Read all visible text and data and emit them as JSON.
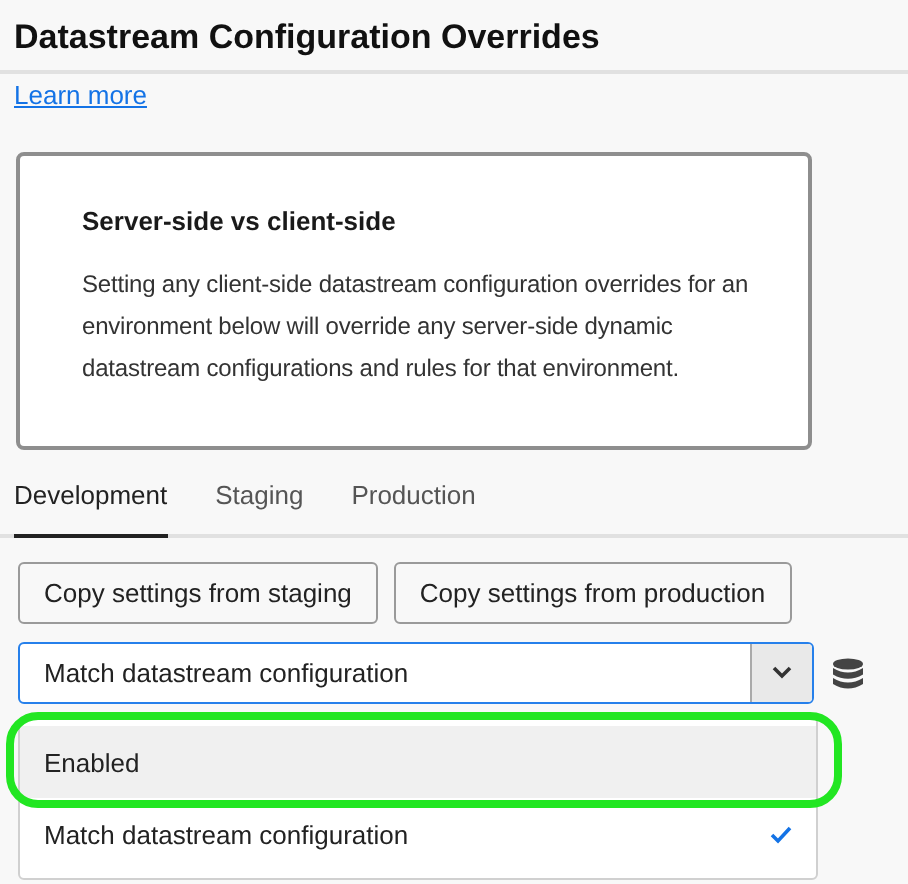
{
  "title": "Datastream Configuration Overrides",
  "learn_more": "Learn more",
  "info_card": {
    "heading": "Server-side vs client-side",
    "body": "Setting any client-side datastream configuration overrides for an environment below will override any server-side dynamic datastream configurations and rules for that environment."
  },
  "tabs": [
    {
      "label": "Development",
      "selected": true
    },
    {
      "label": "Staging",
      "selected": false
    },
    {
      "label": "Production",
      "selected": false
    }
  ],
  "buttons": [
    "Copy settings from staging",
    "Copy settings from production"
  ],
  "select": {
    "value": "Match datastream configuration",
    "expanded": true
  },
  "options": [
    {
      "label": "Enabled",
      "selected": false,
      "hovered": true,
      "highlighted": true
    },
    {
      "label": "Match datastream configuration",
      "selected": true,
      "hovered": false,
      "highlighted": false
    }
  ]
}
